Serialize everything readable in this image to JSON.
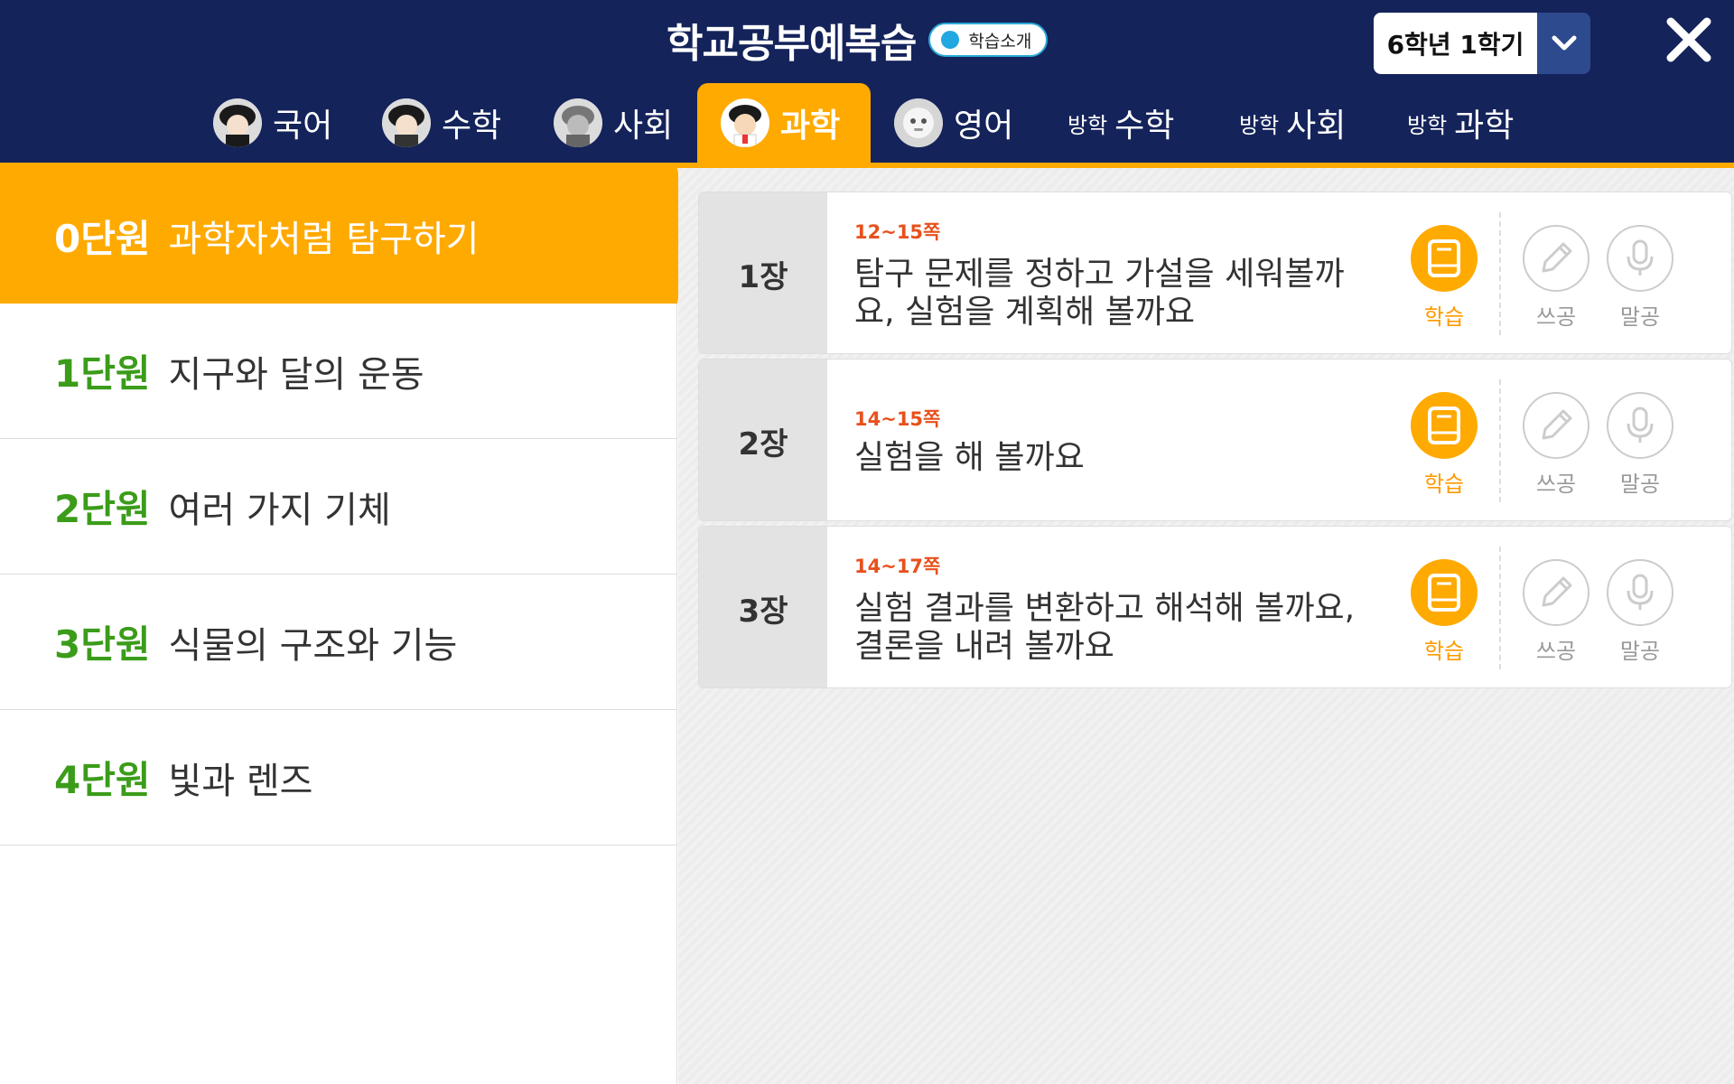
{
  "header": {
    "title": "학교공부예복습",
    "intro_badge": "학습소개",
    "grade_select": "6학년 1학기",
    "close_icon": "close-icon"
  },
  "tabs": [
    {
      "label": "국어",
      "prefix": "",
      "icon": "character-avatar-icon",
      "active": false
    },
    {
      "label": "수학",
      "prefix": "",
      "icon": "character-avatar-icon",
      "active": false
    },
    {
      "label": "사회",
      "prefix": "",
      "icon": "character-avatar-icon",
      "active": false
    },
    {
      "label": "과학",
      "prefix": "",
      "icon": "character-avatar-icon",
      "active": true
    },
    {
      "label": "영어",
      "prefix": "",
      "icon": "robot-avatar-icon",
      "active": false
    },
    {
      "label": "수학",
      "prefix": "방학",
      "icon": "",
      "active": false
    },
    {
      "label": "사회",
      "prefix": "방학",
      "icon": "",
      "active": false
    },
    {
      "label": "과학",
      "prefix": "방학",
      "icon": "",
      "active": false
    }
  ],
  "units": [
    {
      "num": "0단원",
      "title": "과학자처럼 탐구하기",
      "active": true
    },
    {
      "num": "1단원",
      "title": "지구와 달의 운동",
      "active": false
    },
    {
      "num": "2단원",
      "title": "여러 가지 기체",
      "active": false
    },
    {
      "num": "3단원",
      "title": "식물의 구조와 기능",
      "active": false
    },
    {
      "num": "4단원",
      "title": "빛과 렌즈",
      "active": false
    }
  ],
  "lessons": [
    {
      "num": "1장",
      "pages": "12~15쪽",
      "title_lines": [
        "탐구 문제를 정하고 가설을 세워볼까",
        "요, 실험을 계획해 볼까요"
      ]
    },
    {
      "num": "2장",
      "pages": "14~15쪽",
      "title_lines": [
        "실험을 해 볼까요"
      ]
    },
    {
      "num": "3장",
      "pages": "14~17쪽",
      "title_lines": [
        "실험 결과를 변환하고 해석해 볼까요,",
        "결론을 내려 볼까요"
      ]
    }
  ],
  "actions": {
    "study_label": "학습",
    "write_label": "쓰공",
    "speak_label": "말공",
    "study_icon": "book-icon",
    "write_icon": "pencil-icon",
    "speak_icon": "microphone-icon"
  },
  "colors": {
    "header_bg": "#14235a",
    "accent_orange": "#ffaa00",
    "unit_green": "#3b9c1a",
    "page_red": "#e8501c"
  }
}
